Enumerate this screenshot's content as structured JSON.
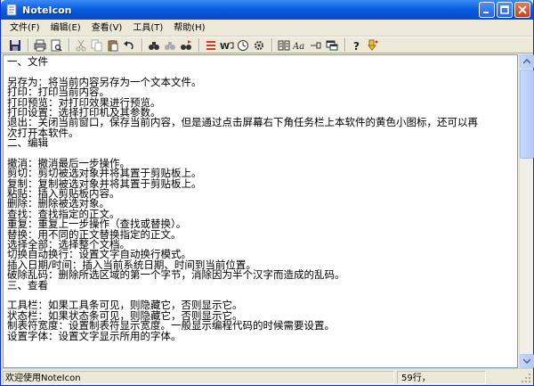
{
  "window": {
    "title": "NoteIcon"
  },
  "menu": [
    {
      "label": "文件(F)"
    },
    {
      "label": "编辑(E)"
    },
    {
      "label": "查看(V)"
    },
    {
      "label": "工具(T)"
    },
    {
      "label": "帮助(H)"
    }
  ],
  "editor": {
    "lines": [
      "一、文件",
      "",
      "另存为：将当前内容另存为一个文本文件。",
      "打印：打印当前内容。",
      "打印预览：对打印效果进行预览。",
      "打印设置：选择打印机及其参数。",
      "退出：关闭当前窗口，保存当前内容，但是通过点击屏幕右下角任务栏上本软件的黄色小图标，还可以再",
      "次打开本软件。",
      "二、编辑",
      "",
      "撤消：撤消最后一步操作。",
      "剪切：剪切被选对象并将其置于剪贴板上。",
      "复制：复制被选对象并将其置于剪贴板上。",
      "粘贴：插入剪贴板内容。",
      "删除：删除被选对象。",
      "查找：查找指定的正文。",
      "重复：重复上一步操作（查找或替换）。",
      "替换：用不同的正文替换指定的正文。",
      "选择全部：选择整个文档。",
      "切换自动换行：设置文字自动换行模式。",
      "插入日期/时间：插入当前系统日期、时间到当前位置。",
      "破除乱码：删除所选区域的第一个字节，消除因为半个汉字而造成的乱码。",
      "三、查看",
      "",
      "工具栏：如果工具条可见，则隐藏它，否则显示它。",
      "状态栏：如果状态条可见，则隐藏它，否则显示它。",
      "制表符宽度：设置制表符显示宽度。一般显示编程代码的时候需要设置。",
      "设置字体：设置文字显示所用的字体。"
    ]
  },
  "statusbar": {
    "message": "欢迎使用NoteIcon",
    "count": "59行，"
  },
  "colors": {
    "titlebar": "#0a5fe0",
    "chrome": "#ece9d8",
    "accent_red": "#d9372a",
    "accent_yellow": "#f2c230"
  }
}
